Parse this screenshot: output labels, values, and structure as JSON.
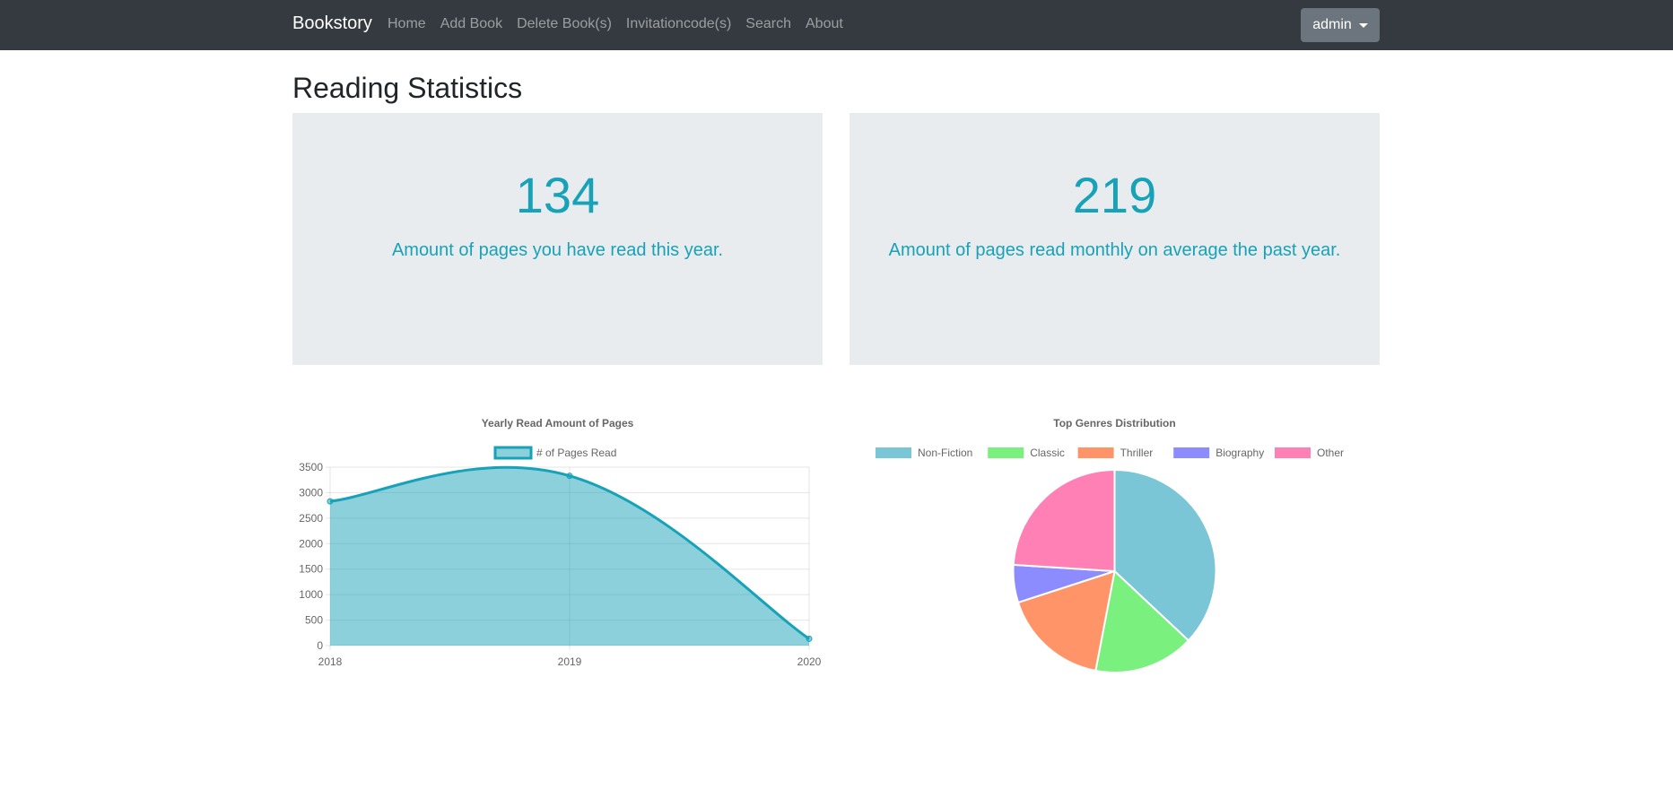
{
  "nav": {
    "brand": "Bookstory",
    "links": [
      "Home",
      "Add Book",
      "Delete Book(s)",
      "Invitationcode(s)",
      "Search",
      "About"
    ],
    "user": "admin"
  },
  "page": {
    "title": "Reading Statistics"
  },
  "stats": [
    {
      "value": "134",
      "label": "Amount of pages you have read this year."
    },
    {
      "value": "219",
      "label": "Amount of pages read monthly on average the past year."
    }
  ],
  "colors": {
    "accent": "#17a2b8",
    "navbar": "#343a40",
    "card": "#e9ecef"
  },
  "chart_data": [
    {
      "type": "area",
      "title": "Yearly Read Amount of Pages",
      "categories": [
        "2018",
        "2019",
        "2020"
      ],
      "series": [
        {
          "name": "# of Pages Read",
          "values": [
            2830,
            3330,
            134
          ],
          "color": "#17a2b8"
        }
      ],
      "ylim": [
        0,
        3500
      ],
      "yticks": [
        0,
        500,
        1000,
        1500,
        2000,
        2500,
        3000,
        3500
      ],
      "legend": "top",
      "grid": true
    },
    {
      "type": "pie",
      "title": "Top Genres Distribution",
      "labels": [
        "Non-Fiction",
        "Classic",
        "Thriller",
        "Biography",
        "Other"
      ],
      "values": [
        37,
        16,
        17,
        6,
        24
      ],
      "colors": [
        "#7ac6d6",
        "#7af07f",
        "#ff9468",
        "#8c8cff",
        "#ff80b4"
      ],
      "legend": "top"
    }
  ]
}
